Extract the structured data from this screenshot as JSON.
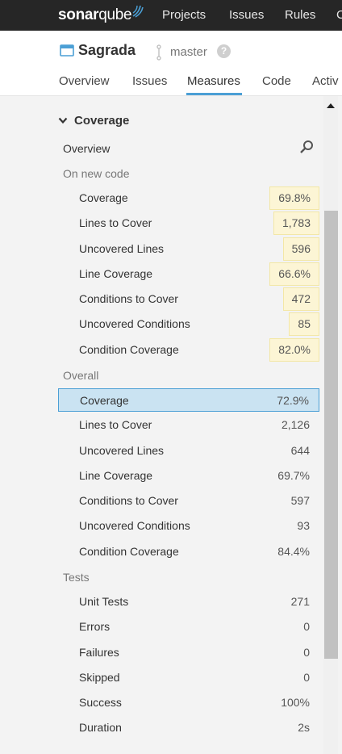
{
  "app": {
    "logo_bold": "sonar",
    "logo_thin": "qube",
    "nav": [
      {
        "label": "Projects"
      },
      {
        "label": "Issues"
      },
      {
        "label": "Rules"
      },
      {
        "label": "C"
      }
    ]
  },
  "project": {
    "name": "Sagrada",
    "branch": "master",
    "help": "?",
    "tabs": [
      {
        "label": "Overview"
      },
      {
        "label": "Issues"
      },
      {
        "label": "Measures"
      },
      {
        "label": "Code"
      },
      {
        "label": "Activ"
      }
    ]
  },
  "sidebar": {
    "domain": "Coverage",
    "overview": "Overview",
    "new_code": {
      "label": "On new code",
      "items": [
        {
          "label": "Coverage",
          "value": "69.8%"
        },
        {
          "label": "Lines to Cover",
          "value": "1,783"
        },
        {
          "label": "Uncovered Lines",
          "value": "596"
        },
        {
          "label": "Line Coverage",
          "value": "66.6%"
        },
        {
          "label": "Conditions to Cover",
          "value": "472"
        },
        {
          "label": "Uncovered Conditions",
          "value": "85"
        },
        {
          "label": "Condition Coverage",
          "value": "82.0%"
        }
      ]
    },
    "overall": {
      "label": "Overall",
      "items": [
        {
          "label": "Coverage",
          "value": "72.9%"
        },
        {
          "label": "Lines to Cover",
          "value": "2,126"
        },
        {
          "label": "Uncovered Lines",
          "value": "644"
        },
        {
          "label": "Line Coverage",
          "value": "69.7%"
        },
        {
          "label": "Conditions to Cover",
          "value": "597"
        },
        {
          "label": "Uncovered Conditions",
          "value": "93"
        },
        {
          "label": "Condition Coverage",
          "value": "84.4%"
        }
      ]
    },
    "tests": {
      "label": "Tests",
      "items": [
        {
          "label": "Unit Tests",
          "value": "271"
        },
        {
          "label": "Errors",
          "value": "0"
        },
        {
          "label": "Failures",
          "value": "0"
        },
        {
          "label": "Skipped",
          "value": "0"
        },
        {
          "label": "Success",
          "value": "100%"
        },
        {
          "label": "Duration",
          "value": "2s"
        }
      ]
    }
  },
  "colors": {
    "topbar": "#262626",
    "accent": "#4b9fd5",
    "new_code_bg": "#fcf5d5",
    "selected_bg": "#cae3f2"
  }
}
